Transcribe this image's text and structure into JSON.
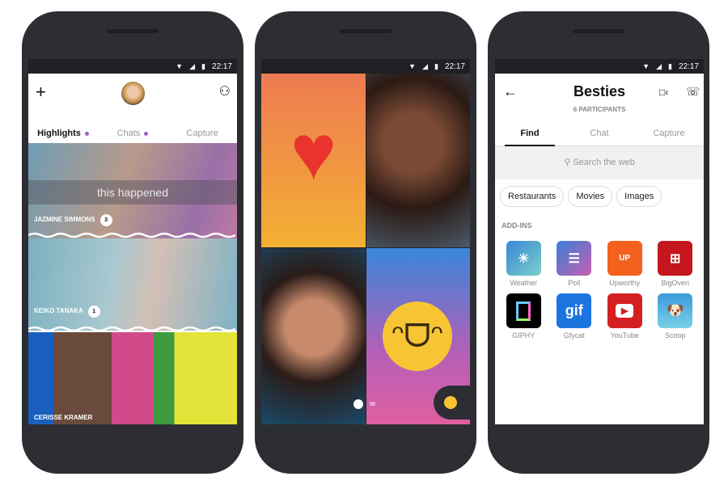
{
  "status": {
    "time": "22:17"
  },
  "phone1": {
    "tabs": [
      {
        "label": "Highlights",
        "dot": true
      },
      {
        "label": "Chats",
        "dot": true
      },
      {
        "label": "Capture",
        "dot": false
      }
    ],
    "stories": [
      {
        "name": "JAZMINE SIMMONS",
        "count": "3",
        "caption": "this happened"
      },
      {
        "name": "KEIKO TANAKA",
        "count": "1"
      },
      {
        "name": "CERISSE KRAMER"
      }
    ]
  },
  "phone3": {
    "title": "Besties",
    "subtitle": "6 PARTICIPANTS",
    "tabs": [
      {
        "label": "Find"
      },
      {
        "label": "Chat"
      },
      {
        "label": "Capture"
      }
    ],
    "search_placeholder": "Search the web",
    "chips": [
      "Restaurants",
      "Movies",
      "Images"
    ],
    "section": "ADD-INS",
    "apps": [
      {
        "label": "Weather",
        "color": "#3a8fd8"
      },
      {
        "label": "Poll",
        "color": "#6a6fd6"
      },
      {
        "label": "Upworthy",
        "color": "#f3611c"
      },
      {
        "label": "BigOven",
        "color": "#c4161c"
      },
      {
        "label": "GIPHY",
        "color": "#000000"
      },
      {
        "label": "Gfycat",
        "color": "#1c74e0"
      },
      {
        "label": "YouTube",
        "color": "#d42020"
      },
      {
        "label": "Scoop",
        "color": "#3a9ad8"
      }
    ]
  },
  "accent": "#6b6bd8"
}
